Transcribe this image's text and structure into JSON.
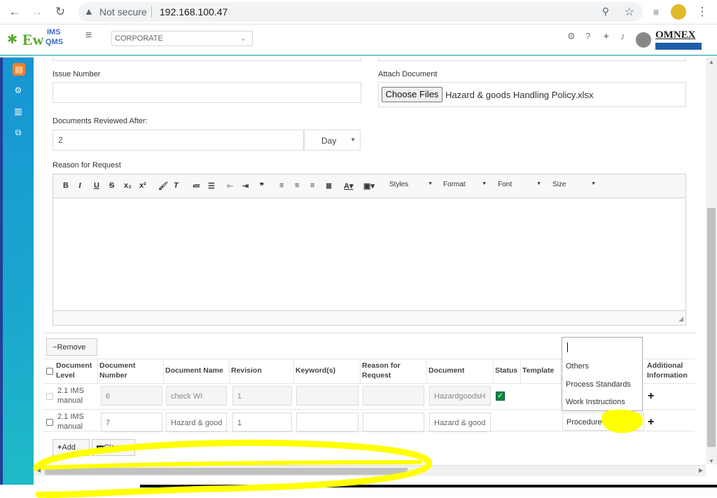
{
  "browser": {
    "not_secure": "Not secure",
    "url": "192.168.100.47"
  },
  "app": {
    "logo_ew": "Ew",
    "logo_ims": "IMS",
    "logo_qms": "QMS",
    "company_select": "CORPORATE",
    "brand": "OMNEX"
  },
  "form": {
    "issue_number_label": "Issue Number",
    "issue_number_value": "",
    "attach_label": "Attach Document",
    "choose_files": "Choose Files",
    "attached_file": "Hazard & goods Handling Policy.xlsx",
    "reviewed_after_label": "Documents Reviewed After:",
    "reviewed_after_value": "2",
    "reviewed_unit": "Day",
    "reason_label": "Reason for Request"
  },
  "editor": {
    "styles": "Styles",
    "format": "Format",
    "font": "Font",
    "size": "Size"
  },
  "grid": {
    "remove_label": "Remove",
    "headers": {
      "level": "Document Level",
      "number": "Document Number",
      "name": "Document Name",
      "revision": "Revision",
      "keywords": "Keyword(s)",
      "reason": "Reason for Request",
      "document": "Document",
      "status": "Status",
      "template": "Template",
      "additional": "Additional Information"
    },
    "rows": [
      {
        "level": "2.1 IMS manual",
        "number": "6",
        "name": "check WI",
        "revision": "1",
        "document": "HazardgoodsH"
      },
      {
        "level": "2.1 IMS manual",
        "number": "7",
        "name": "Hazard & good",
        "revision": "1",
        "document": "Hazard & good",
        "type": "Procedure"
      }
    ],
    "dropdown_options": [
      "Others",
      "Process Standards",
      "Work Instructions"
    ],
    "add_label": "Add",
    "close_label": "Close"
  },
  "colors": {
    "accent": "#6fc5c7",
    "sidebar_top": "#1795d2",
    "highlight": "#ffff00"
  }
}
